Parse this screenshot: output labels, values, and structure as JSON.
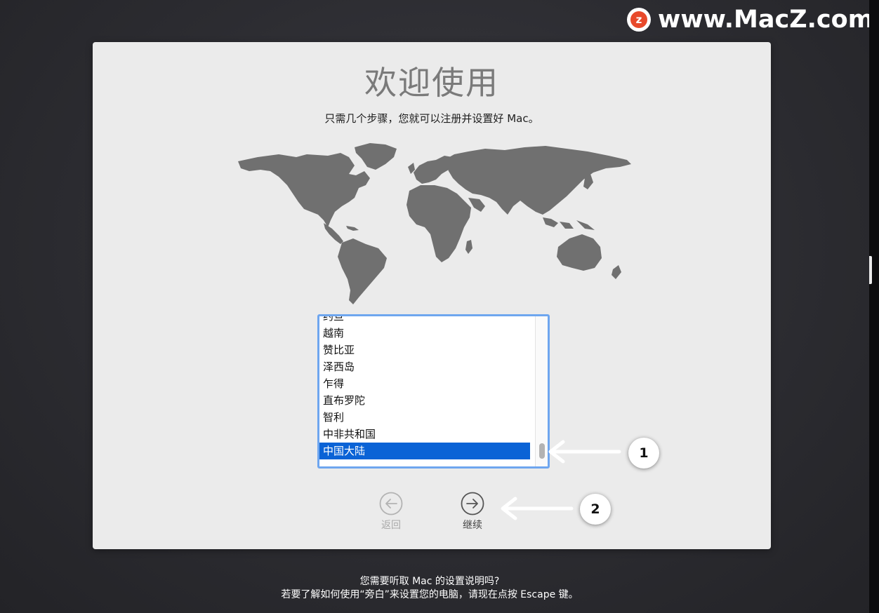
{
  "watermark": {
    "logo_letter": "z",
    "text": "www.MacZ.com"
  },
  "welcome": {
    "title": "欢迎使用",
    "subtitle": "只需几个步骤，您就可以注册并设置好 Mac。"
  },
  "country_list": {
    "items": [
      {
        "label": "约旦",
        "selected": false
      },
      {
        "label": "越南",
        "selected": false
      },
      {
        "label": "赞比亚",
        "selected": false
      },
      {
        "label": "泽西岛",
        "selected": false
      },
      {
        "label": "乍得",
        "selected": false
      },
      {
        "label": "直布罗陀",
        "selected": false
      },
      {
        "label": "智利",
        "selected": false
      },
      {
        "label": "中非共和国",
        "selected": false
      },
      {
        "label": "中国大陆",
        "selected": true
      }
    ]
  },
  "nav": {
    "back_label": "返回",
    "continue_label": "继续"
  },
  "annotations": {
    "badge1": "1",
    "badge2": "2"
  },
  "voiceover": {
    "line1": "您需要听取 Mac 的设置说明吗?",
    "line2": "若要了解如何使用“旁白”来设置您的电脑，请现在点按 Escape 键。"
  },
  "colors": {
    "selection": "#0a63d6",
    "focus_ring": "#6ea6ef",
    "map_land": "#707070",
    "panel_bg": "#ebebeb"
  }
}
